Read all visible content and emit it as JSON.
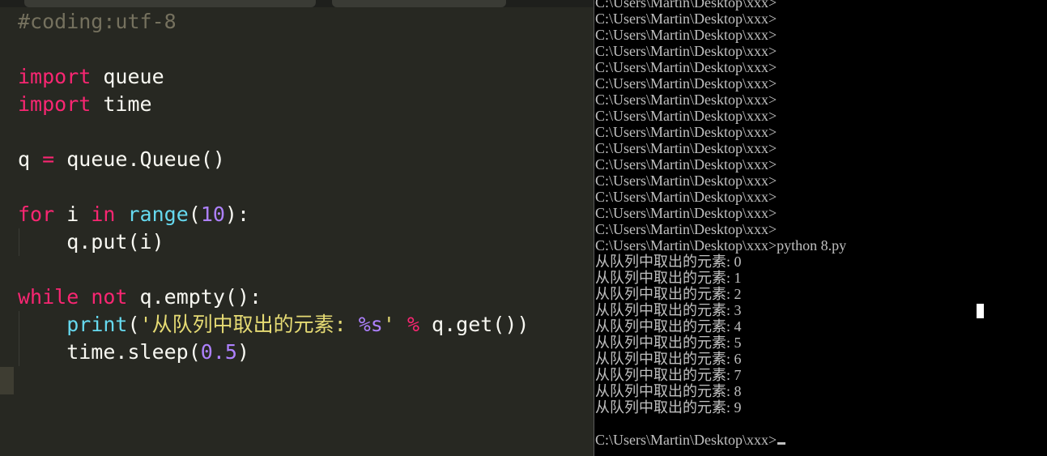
{
  "editor": {
    "lines": [
      {
        "cm": "#coding:utf-8"
      },
      {},
      {
        "kw": "import",
        "rest": " queue"
      },
      {
        "kw": "import",
        "rest": " time"
      },
      {},
      {
        "a": "q ",
        "op": "=",
        "b": " queue.Queue()"
      },
      {},
      {
        "kw1": "for",
        "a": " i ",
        "kw2": "in",
        "sp": " ",
        "fn": "range",
        "p1": "(",
        "num": "10",
        "p2": "):"
      },
      {
        "a": "    q.put(i)"
      },
      {},
      {
        "kw1": "while",
        "sp": " ",
        "kw2": "not",
        "b": " q.empty():"
      },
      {
        "ind": "    ",
        "fn": "print",
        "p1": "(",
        "str1": "'从队列中取出的元素: ",
        "fmt": "%s",
        "str2": "'",
        "sp": " ",
        "op": "%",
        "b": " q.get())"
      },
      {
        "a": "    time.sleep(",
        "num": "0.5",
        "b": ")"
      }
    ],
    "colors": {
      "background": "#272822",
      "comment": "#75715e",
      "keyword": "#f92672",
      "builtin": "#66d9ef",
      "number": "#ae81ff",
      "string": "#e6db74",
      "text": "#f8f8f2"
    }
  },
  "console": {
    "lines": [
      "C:\\Users\\Martin\\Desktop\\xxx>",
      "C:\\Users\\Martin\\Desktop\\xxx>",
      "C:\\Users\\Martin\\Desktop\\xxx>",
      "C:\\Users\\Martin\\Desktop\\xxx>",
      "C:\\Users\\Martin\\Desktop\\xxx>",
      "C:\\Users\\Martin\\Desktop\\xxx>",
      "C:\\Users\\Martin\\Desktop\\xxx>",
      "C:\\Users\\Martin\\Desktop\\xxx>",
      "C:\\Users\\Martin\\Desktop\\xxx>",
      "C:\\Users\\Martin\\Desktop\\xxx>",
      "C:\\Users\\Martin\\Desktop\\xxx>",
      "C:\\Users\\Martin\\Desktop\\xxx>",
      "C:\\Users\\Martin\\Desktop\\xxx>",
      "C:\\Users\\Martin\\Desktop\\xxx>",
      "C:\\Users\\Martin\\Desktop\\xxx>",
      "C:\\Users\\Martin\\Desktop\\xxx>python 8.py",
      "从队列中取出的元素: 0",
      "从队列中取出的元素: 1",
      "从队列中取出的元素: 2",
      "从队列中取出的元素: 3",
      "从队列中取出的元素: 4",
      "从队列中取出的元素: 5",
      "从队列中取出的元素: 6",
      "从队列中取出的元素: 7",
      "从队列中取出的元素: 8",
      "从队列中取出的元素: 9",
      "",
      "C:\\Users\\Martin\\Desktop\\xxx>"
    ],
    "colors": {
      "background": "#000000",
      "text": "#c0c0c0"
    }
  }
}
